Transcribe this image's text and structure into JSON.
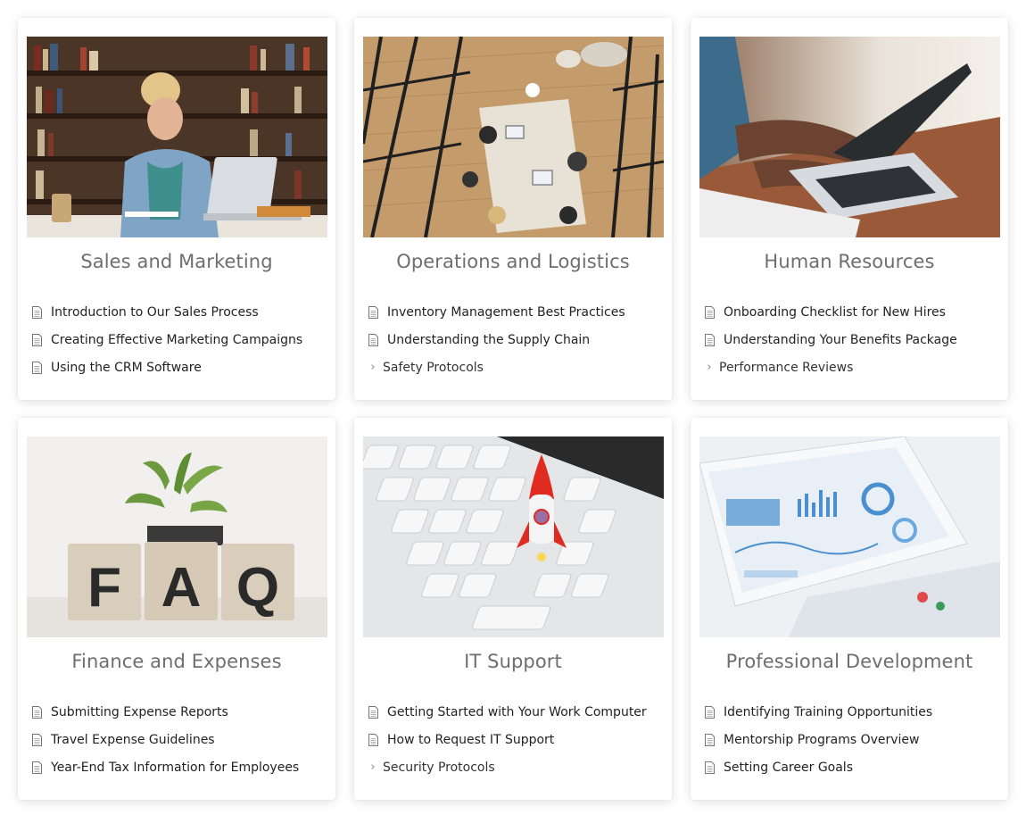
{
  "categories": [
    {
      "title": "Sales and Marketing",
      "image_name": "sales-marketing-photo",
      "items": [
        {
          "label": "Introduction to Our Sales Process",
          "kind": "document"
        },
        {
          "label": "Creating Effective Marketing Campaigns",
          "kind": "document"
        },
        {
          "label": "Using the CRM Software",
          "kind": "document"
        }
      ]
    },
    {
      "title": "Operations and Logistics",
      "image_name": "operations-logistics-photo",
      "items": [
        {
          "label": "Inventory Management Best Practices",
          "kind": "document"
        },
        {
          "label": "Understanding the Supply Chain",
          "kind": "document"
        },
        {
          "label": "Safety Protocols",
          "kind": "section"
        }
      ]
    },
    {
      "title": "Human Resources",
      "image_name": "human-resources-photo",
      "items": [
        {
          "label": "Onboarding Checklist for New Hires",
          "kind": "document"
        },
        {
          "label": "Understanding Your Benefits Package",
          "kind": "document"
        },
        {
          "label": "Performance Reviews",
          "kind": "section"
        }
      ]
    },
    {
      "title": "Finance and Expenses",
      "image_name": "finance-faq-photo",
      "image_text": "FAQ",
      "items": [
        {
          "label": "Submitting Expense Reports",
          "kind": "document"
        },
        {
          "label": "Travel Expense Guidelines",
          "kind": "document"
        },
        {
          "label": "Year-End Tax Information for Employees",
          "kind": "document"
        }
      ]
    },
    {
      "title": "IT Support",
      "image_name": "it-support-photo",
      "items": [
        {
          "label": "Getting Started with Your Work Computer",
          "kind": "document"
        },
        {
          "label": "How to Request IT Support",
          "kind": "document"
        },
        {
          "label": "Security Protocols",
          "kind": "section"
        }
      ]
    },
    {
      "title": "Professional Development",
      "image_name": "professional-development-photo",
      "items": [
        {
          "label": "Identifying Training Opportunities",
          "kind": "document"
        },
        {
          "label": "Mentorship Programs Overview",
          "kind": "document"
        },
        {
          "label": "Setting Career Goals",
          "kind": "document"
        }
      ]
    }
  ]
}
